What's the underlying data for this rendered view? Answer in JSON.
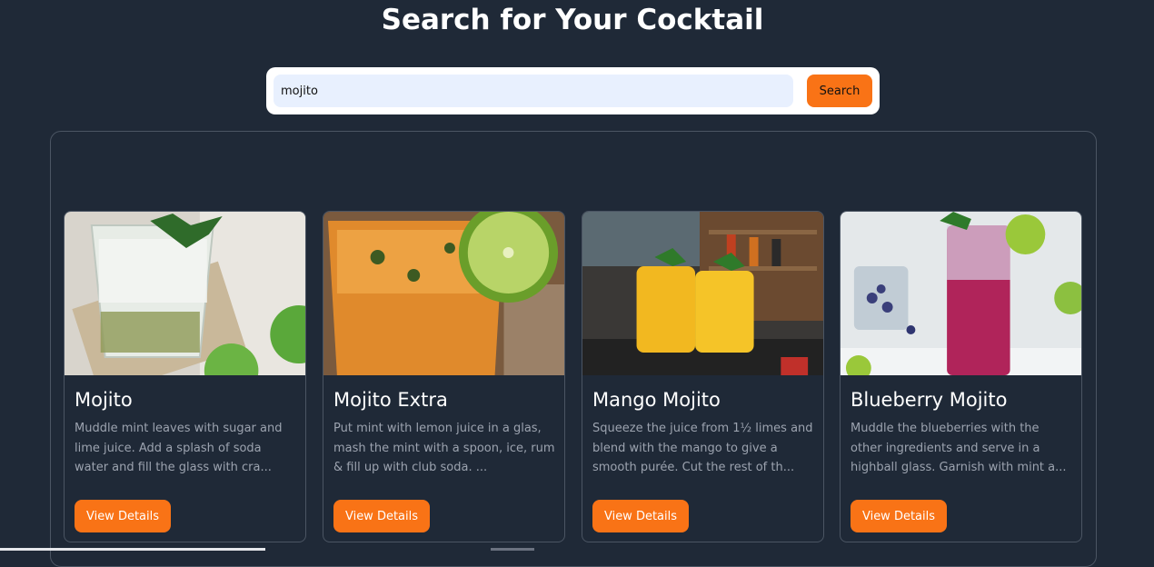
{
  "header": {
    "title": "Search for Your Cocktail"
  },
  "search": {
    "value": "mojito",
    "button_label": "Search"
  },
  "cards": [
    {
      "title": "Mojito",
      "description": "Muddle mint leaves with sugar and lime juice. Add a splash of soda water and fill the glass with cra...",
      "button_label": "View Details"
    },
    {
      "title": "Mojito Extra",
      "description": "Put mint with lemon juice in a glas, mash the mint with a spoon, ice, rum & fill up with club soda. ...",
      "button_label": "View Details"
    },
    {
      "title": "Mango Mojito",
      "description": "Squeeze the juice from 1½ limes and blend with the mango to give a smooth purée. Cut the rest of th...",
      "button_label": "View Details"
    },
    {
      "title": "Blueberry Mojito",
      "description": "Muddle the blueberries with the other ingredients and serve in a highball glass. Garnish with mint a...",
      "button_label": "View Details"
    }
  ],
  "colors": {
    "background": "#1f2937",
    "accent": "#f97316",
    "muted_text": "#9ca3af"
  }
}
